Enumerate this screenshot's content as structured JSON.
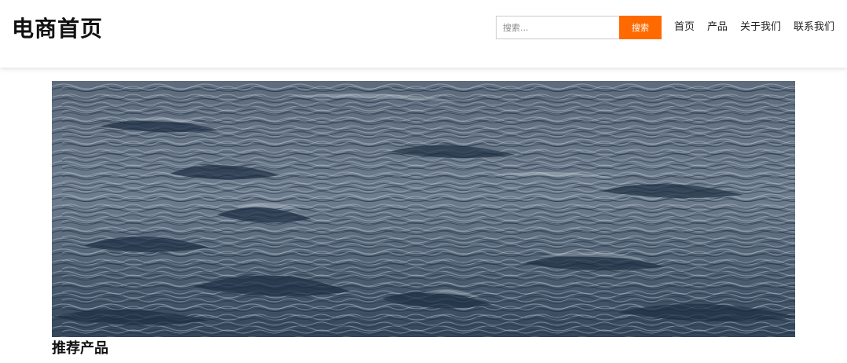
{
  "header": {
    "logo": "电商首页",
    "search": {
      "placeholder": "搜索...",
      "value": "",
      "button_label": "搜索"
    },
    "nav": [
      {
        "label": "首页"
      },
      {
        "label": "产品"
      },
      {
        "label": "关于我们"
      },
      {
        "label": "联系我们"
      }
    ]
  },
  "hero": {
    "image_subject": "ocean waves"
  },
  "main": {
    "section_title": "推荐产品"
  },
  "colors": {
    "accent": "#ff6a00",
    "text": "#111111",
    "background": "#ffffff"
  }
}
